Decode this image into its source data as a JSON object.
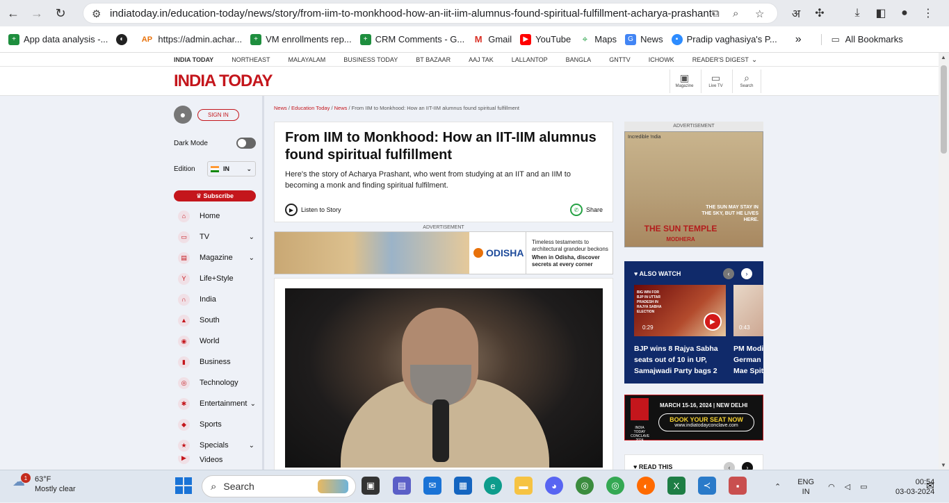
{
  "browser": {
    "url": "indiatoday.in/education-today/news/story/from-iim-to-monkhood-how-an-iit-iim-alumnus-found-spiritual-fulfillment-acharya-prashant-...",
    "profile_letter": "अ"
  },
  "bookmarks": [
    {
      "label": "App data analysis -...",
      "icon": "sheets-icon",
      "color": "#1e8e3e"
    },
    {
      "label": "",
      "icon": "globe-icon",
      "color": "#222"
    },
    {
      "label": "https://admin.achar...",
      "icon": "ap-icon",
      "color": "#e8710a"
    },
    {
      "label": "VM enrollments rep...",
      "icon": "sheets-icon",
      "color": "#1e8e3e"
    },
    {
      "label": "CRM Comments - G...",
      "icon": "sheets-icon",
      "color": "#1e8e3e"
    },
    {
      "label": "Gmail",
      "icon": "gmail-icon",
      "color": "#d93025"
    },
    {
      "label": "YouTube",
      "icon": "youtube-icon",
      "color": "#ff0000"
    },
    {
      "label": "Maps",
      "icon": "maps-icon",
      "color": "#34a853"
    },
    {
      "label": "News",
      "icon": "news-icon",
      "color": "#4285f4"
    },
    {
      "label": "Pradip vaghasiya's P...",
      "icon": "zoom-icon",
      "color": "#2d8cff"
    }
  ],
  "bookmarks_more": "»",
  "all_bookmarks": "All Bookmarks",
  "brand_row": [
    "INDIA TODAY",
    "NORTHEAST",
    "MALAYALAM",
    "BUSINESS TODAY",
    "BT BAZAAR",
    "AAJ TAK",
    "LALLANTOP",
    "BANGLA",
    "GNTTV",
    "ICHOWK",
    "READER'S DIGEST"
  ],
  "header": {
    "logo": "INDIA TODAY",
    "magazine": "Magazine",
    "live_tv": "Live TV",
    "search": "Search"
  },
  "sidebar": {
    "sign_in": "SIGN IN",
    "dark_mode": "Dark Mode",
    "edition_label": "Edition",
    "edition_value": "IN",
    "subscribe": "Subscribe",
    "items": [
      {
        "label": "Home",
        "icon": "home-icon",
        "chevron": false
      },
      {
        "label": "TV",
        "icon": "tv-icon",
        "chevron": true
      },
      {
        "label": "Magazine",
        "icon": "magazine-icon",
        "chevron": true
      },
      {
        "label": "Life+Style",
        "icon": "cocktail-icon",
        "chevron": false
      },
      {
        "label": "India",
        "icon": "india-gate-icon",
        "chevron": false
      },
      {
        "label": "South",
        "icon": "temple-icon",
        "chevron": false
      },
      {
        "label": "World",
        "icon": "globe-icon",
        "chevron": false
      },
      {
        "label": "Business",
        "icon": "chart-icon",
        "chevron": false
      },
      {
        "label": "Technology",
        "icon": "technology-icon",
        "chevron": false
      },
      {
        "label": "Entertainment",
        "icon": "film-icon",
        "chevron": true
      },
      {
        "label": "Sports",
        "icon": "sports-icon",
        "chevron": false
      },
      {
        "label": "Specials",
        "icon": "specials-icon",
        "chevron": true
      },
      {
        "label": "Videos",
        "icon": "video-icon",
        "chevron": false
      }
    ]
  },
  "breadcrumb": [
    {
      "label": "News",
      "link": true
    },
    {
      "label": "Education Today",
      "link": true
    },
    {
      "label": "News",
      "link": true
    },
    {
      "label": "From IIM to Monkhood: How an IIT-IIM alumnus found spiritual fulfillment",
      "link": false
    }
  ],
  "article": {
    "title": "From IIM to Monkhood: How an IIT-IIM alumnus found spiritual fulfillment",
    "summary": "Here's the story of Acharya Prashant, who went from studying at an IIT and an IIM to becoming a monk and finding spiritual fulfilment.",
    "listen": "Listen to Story",
    "share": "Share"
  },
  "ads": {
    "label": "ADVERTISEMENT",
    "odisha_logo": "ODISHA",
    "odisha_text1": "Timeless testaments to architectural grandeur beckons",
    "odisha_text2": "When in Odisha, discover secrets at every corner",
    "right_label": "ADVERTISEMENT",
    "right_small": "Incredible !ndia",
    "right_tag": "THE SUN MAY STAY IN THE SKY, BUT HE LIVES HERE.",
    "right_title": "THE SUN TEMPLE",
    "right_sub": "MODHERA"
  },
  "also_watch": {
    "heading": "ALSO WATCH",
    "items": [
      {
        "caption": "BJP wins 8 Rajya Sabha seats out of 10 in UP, Samajwadi Party bags 2",
        "duration": "0:29",
        "thumb_text": "BIG WIN FOR BJP IN UTTAR PRADESH IN RAJYA SABHA ELECTION"
      },
      {
        "caption": "PM Modi German Mae Spit",
        "duration": "0:43"
      }
    ]
  },
  "conclave": {
    "date": "MARCH 15-16, 2024 | NEW DELHI",
    "book": "BOOK YOUR SEAT NOW",
    "site": "www.indiatodayconclave.com",
    "logo": "INDIA TODAY CONCLAVE 2024"
  },
  "read_this": {
    "heading": "READ THIS"
  },
  "taskbar": {
    "temp": "63°F",
    "weather": "Mostly clear",
    "weather_badge": "1",
    "search": "Search",
    "lang": "ENG",
    "region": "IN",
    "time": "00:54",
    "date": "03-03-2024"
  }
}
